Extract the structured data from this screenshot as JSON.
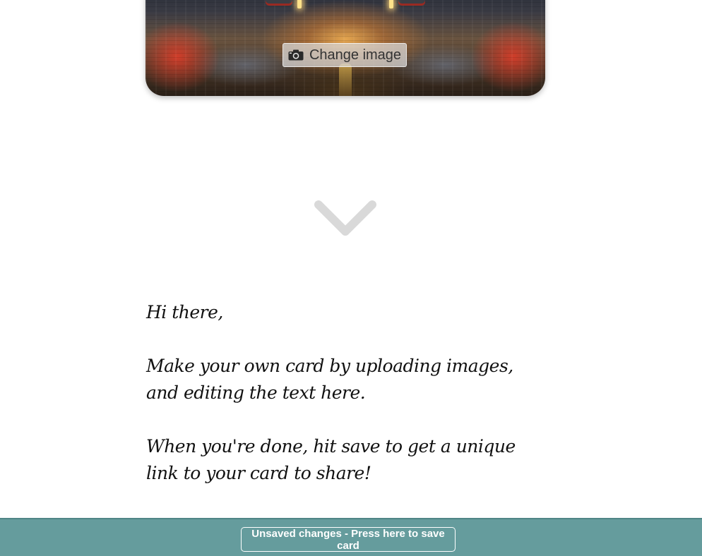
{
  "card": {
    "change_image_label": "Change image",
    "change_image_icon": "camera-icon"
  },
  "scroll": {
    "icon": "chevron-down-icon"
  },
  "message": {
    "paragraphs": [
      "Hi there,",
      "Make your own card by uploading images, and editing the text here.",
      "When you're done, hit save to get a unique link to your card to share!"
    ]
  },
  "save_bar": {
    "button_label": "Unsaved changes - Press here to save card",
    "background_color": "#659c9d"
  }
}
